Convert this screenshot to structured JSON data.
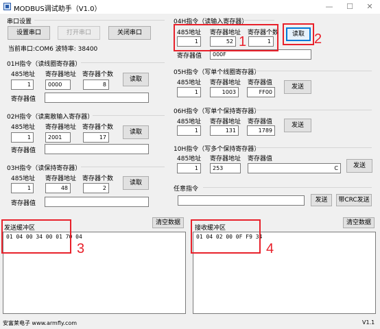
{
  "window": {
    "title": "MODBUS调试助手（V1.0）",
    "minimize": "—",
    "maximize": "☐",
    "close": "✕"
  },
  "serial": {
    "title": "串口设置",
    "setup_button": "设置串口",
    "open_button": "打开串口",
    "close_button": "关闭串口",
    "status": "当前串口:COM6 波特率: 38400"
  },
  "f01": {
    "title": "01H指令（读线圈寄存器）",
    "addr_label": "485地址",
    "reg_label": "寄存器地址",
    "count_label": "寄存器个数",
    "addr": "1",
    "reg": "0000",
    "count": "8",
    "value_label": "寄存器值",
    "value": "",
    "read_button": "读取"
  },
  "f02": {
    "title": "02H指令（读离散输入寄存器）",
    "addr_label": "485地址",
    "reg_label": "寄存器地址",
    "count_label": "寄存器个数",
    "addr": "1",
    "reg": "2001",
    "count": "17",
    "value_label": "寄存器值",
    "value": "",
    "read_button": "读取"
  },
  "f03": {
    "title": "03H指令（读保持寄存器）",
    "addr_label": "485地址",
    "reg_label": "寄存器地址",
    "count_label": "寄存器个数",
    "addr": "1",
    "reg": "48",
    "count": "2",
    "value_label": "寄存器值",
    "value": "",
    "read_button": "读取"
  },
  "f04": {
    "title": "04H指令（读输入寄存器）",
    "addr_label": "485地址",
    "reg_label": "寄存器地址",
    "count_label": "寄存器个数",
    "addr": "1",
    "reg": "52",
    "count": "1",
    "value_label": "寄存器值",
    "value": "000F",
    "read_button": "读取"
  },
  "f05": {
    "title": "05H指令（写单个线圈寄存器）",
    "addr_label": "485地址",
    "reg_label": "寄存器地址",
    "value_label": "寄存器值",
    "addr": "1",
    "reg": "1003",
    "value": "FF00",
    "send_button": "发送"
  },
  "f06": {
    "title": "06H指令（写单个保持寄存器）",
    "addr_label": "485地址",
    "reg_label": "寄存器地址",
    "value_label": "寄存器值",
    "addr": "1",
    "reg": "131",
    "value": "1789",
    "send_button": "发送"
  },
  "f10": {
    "title": "10H指令（写多个保持寄存器）",
    "addr_label": "485地址",
    "reg_label": "寄存器地址",
    "value_label": "寄存器值",
    "addr": "1",
    "reg": "253",
    "value": "C",
    "send_button": "发送"
  },
  "any": {
    "title": "任意指令",
    "value": "",
    "send_button": "发送",
    "crc_button": "带CRC发送"
  },
  "send_buffer": {
    "title": "发送缓冲区",
    "clear_button": "清空数据",
    "content": "01 04 00 34 00 01 70 04"
  },
  "recv_buffer": {
    "title": "接收缓冲区",
    "clear_button": "清空数据",
    "content": "01 04 02 00 0F F9 34"
  },
  "annotations": {
    "n1": "1",
    "n2": "2",
    "n3": "3",
    "n4": "4",
    "color": "#e8202a"
  },
  "footer": {
    "company": "安富莱电子 www.armfly.com",
    "version": "V1.1"
  }
}
